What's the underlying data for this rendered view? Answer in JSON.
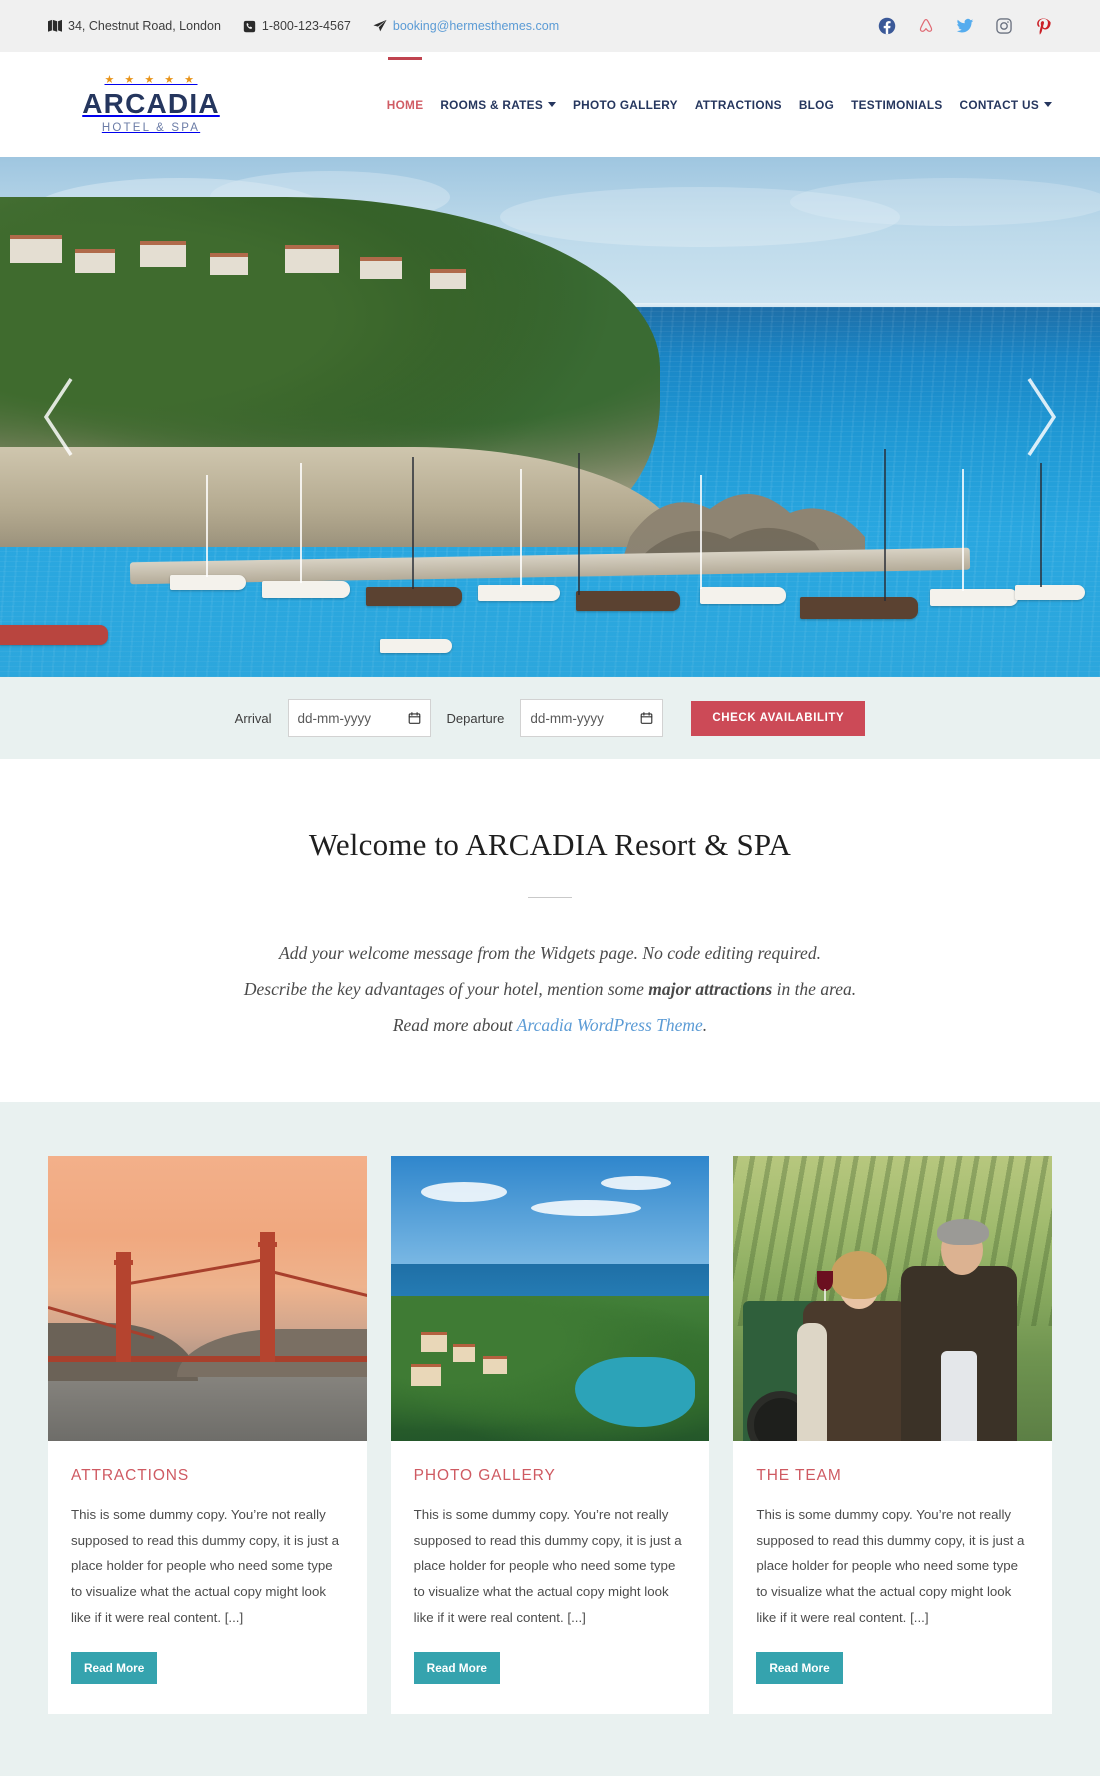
{
  "topbar": {
    "address": "34, Chestnut Road, London",
    "phone": "1-800-123-4567",
    "email": "booking@hermesthemes.com",
    "social": [
      {
        "name": "facebook-icon",
        "label": "Facebook",
        "color": "#3b5998"
      },
      {
        "name": "airbnb-icon",
        "label": "Airbnb",
        "color": "#e06a74"
      },
      {
        "name": "twitter-icon",
        "label": "Twitter",
        "color": "#55acee"
      },
      {
        "name": "instagram-icon",
        "label": "Instagram",
        "color": "#6b7280"
      },
      {
        "name": "pinterest-icon",
        "label": "Pinterest",
        "color": "#cb2027"
      }
    ]
  },
  "logo": {
    "stars": "★ ★ ★ ★ ★",
    "name": "ARCADIA",
    "tagline": "HOTEL & SPA"
  },
  "nav": {
    "items": [
      {
        "label": "HOME",
        "active": true,
        "dropdown": false
      },
      {
        "label": "ROOMS & RATES",
        "active": false,
        "dropdown": true
      },
      {
        "label": "PHOTO GALLERY",
        "active": false,
        "dropdown": false
      },
      {
        "label": "ATTRACTIONS",
        "active": false,
        "dropdown": false
      },
      {
        "label": "BLOG",
        "active": false,
        "dropdown": false
      },
      {
        "label": "TESTIMONIALS",
        "active": false,
        "dropdown": false
      },
      {
        "label": "CONTACT US",
        "active": false,
        "dropdown": true
      }
    ]
  },
  "hero": {
    "prev_label": "Previous slide",
    "next_label": "Next slide",
    "alt": "Marina harbour with boats below a green cliffside town"
  },
  "booking": {
    "arrival_label": "Arrival",
    "arrival_value": "dd-mm-yyyy",
    "departure_label": "Departure",
    "departure_value": "dd-mm-yyyy",
    "submit_label": "CHECK AVAILABILITY",
    "accent_color": "#cc4a57"
  },
  "welcome": {
    "heading": "Welcome to ARCADIA Resort & SPA",
    "line1": "Add your welcome message from the Widgets page. No code editing required.",
    "line2_prefix": "Describe the key advantages of your hotel, mention some ",
    "line2_bold": "major attractions",
    "line2_suffix": " in the area.",
    "line3_prefix": "Read more about ",
    "line3_link": "Arcadia WordPress Theme",
    "line3_suffix": "."
  },
  "cards": [
    {
      "title": "ATTRACTIONS",
      "text": "This is some dummy copy. You’re not really supposed to read this dummy copy, it is just a place holder for people who need some type to visualize what the actual copy might look like if it were real content. [...]",
      "button": "Read More",
      "image_alt": "Golden Gate Bridge at sunset"
    },
    {
      "title": "PHOTO GALLERY",
      "text": "This is some dummy copy. You’re not really supposed to read this dummy copy, it is just a place holder for people who need some type to visualize what the actual copy might look like if it were real content. [...]",
      "button": "Read More",
      "image_alt": "Mediterranean coastal village bay"
    },
    {
      "title": "THE TEAM",
      "text": "This is some dummy copy. You’re not really supposed to read this dummy copy, it is just a place holder for people who need some type to visualize what the actual copy might look like if it were real content. [...]",
      "button": "Read More",
      "image_alt": "Couple holding wine glass in a vineyard"
    }
  ]
}
